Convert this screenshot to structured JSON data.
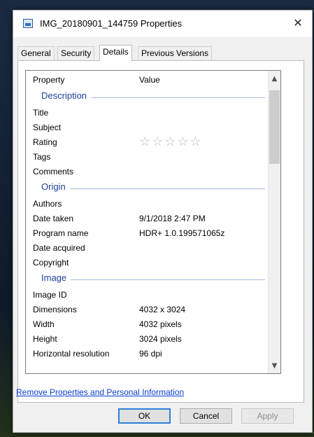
{
  "window": {
    "title": "IMG_20180901_144759 Properties",
    "close_glyph": "✕",
    "title_icon": "image-file-icon"
  },
  "tabs": [
    {
      "label": "General",
      "active": false
    },
    {
      "label": "Security",
      "active": false
    },
    {
      "label": "Details",
      "active": true
    },
    {
      "label": "Previous Versions",
      "active": false
    }
  ],
  "details": {
    "header": {
      "property": "Property",
      "value": "Value"
    },
    "sections": {
      "description": {
        "label": "Description",
        "rows": [
          {
            "key": "Title",
            "value": ""
          },
          {
            "key": "Subject",
            "value": ""
          },
          {
            "key": "Rating",
            "value": "",
            "stars": 5,
            "filled": 0
          },
          {
            "key": "Tags",
            "value": ""
          },
          {
            "key": "Comments",
            "value": ""
          }
        ]
      },
      "origin": {
        "label": "Origin",
        "rows": [
          {
            "key": "Authors",
            "value": ""
          },
          {
            "key": "Date taken",
            "value": "9/1/2018 2:47 PM"
          },
          {
            "key": "Program name",
            "value": "HDR+ 1.0.199571065z"
          },
          {
            "key": "Date acquired",
            "value": ""
          },
          {
            "key": "Copyright",
            "value": ""
          }
        ]
      },
      "image": {
        "label": "Image",
        "rows": [
          {
            "key": "Image ID",
            "value": ""
          },
          {
            "key": "Dimensions",
            "value": "4032 x 3024"
          },
          {
            "key": "Width",
            "value": "4032 pixels"
          },
          {
            "key": "Height",
            "value": "3024 pixels"
          },
          {
            "key": "Horizontal resolution",
            "value": "96 dpi"
          }
        ]
      }
    },
    "rating_stars": "☆☆☆☆☆",
    "scroll_up": "▲",
    "scroll_down": "▼"
  },
  "link": "Remove Properties and Personal Information",
  "buttons": {
    "ok": "OK",
    "cancel": "Cancel",
    "apply": "Apply"
  }
}
